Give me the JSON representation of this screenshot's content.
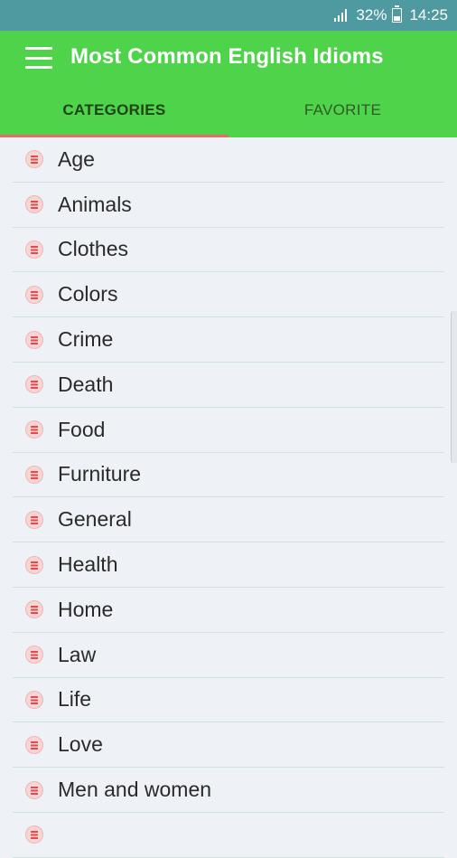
{
  "status": {
    "battery": "32%",
    "time": "14:25"
  },
  "app": {
    "title": "Most Common English Idioms"
  },
  "tabs": [
    {
      "label": "CATEGORIES",
      "active": true
    },
    {
      "label": "FAVORITE",
      "active": false
    }
  ],
  "categories": [
    "Age",
    "Animals",
    "Clothes",
    "Colors",
    "Crime",
    "Death",
    "Food",
    "Furniture",
    "General",
    "Health",
    "Home",
    "Law",
    "Life",
    "Love",
    "Men and women"
  ],
  "colors": {
    "status_bar": "#4f9aa1",
    "app_bar": "#4fd34a",
    "tab_indicator": "#e96a6a",
    "list_icon": "#e64a4a",
    "background": "#eef2f6"
  }
}
